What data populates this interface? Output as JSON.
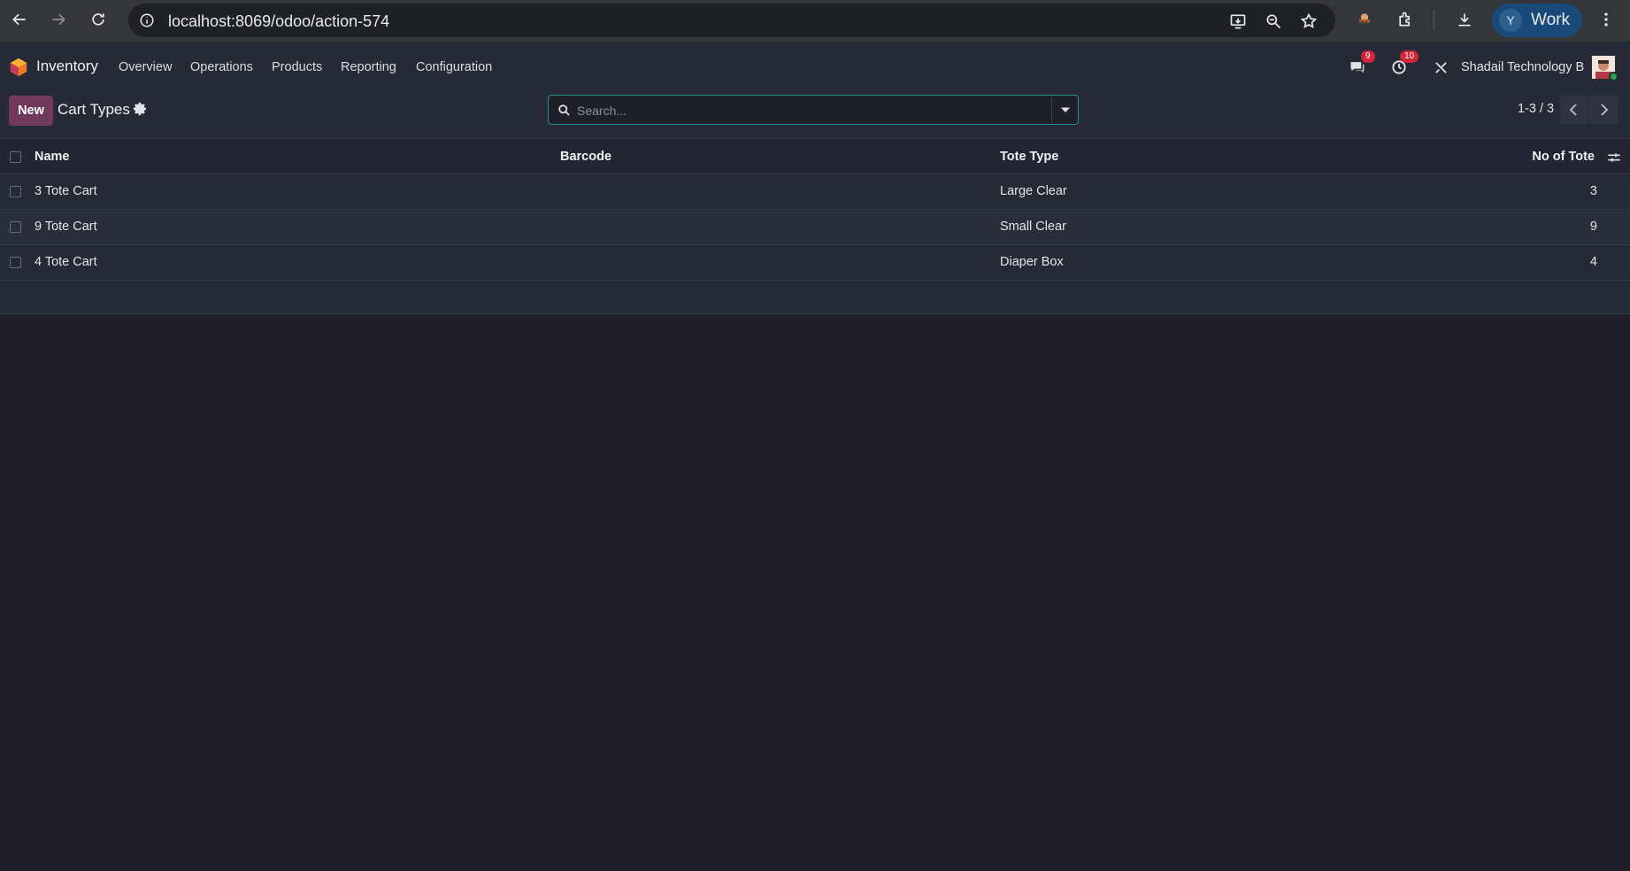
{
  "browser": {
    "url": "localhost:8069/odoo/action-574",
    "profile_initial": "Y",
    "profile_label": "Work"
  },
  "navbar": {
    "app_name": "Inventory",
    "menu": [
      "Overview",
      "Operations",
      "Products",
      "Reporting",
      "Configuration"
    ],
    "messages_count": "9",
    "activities_count": "10",
    "company": "Shadail Technology B"
  },
  "control": {
    "new_label": "New",
    "breadcrumb": "Cart Types",
    "search_placeholder": "Search...",
    "pager": "1-3 / 3"
  },
  "table": {
    "headers": {
      "name": "Name",
      "barcode": "Barcode",
      "tote_type": "Tote Type",
      "count": "No of Tote"
    },
    "rows": [
      {
        "name": "3 Tote Cart",
        "barcode": "",
        "tote_type": "Large Clear",
        "count": "3"
      },
      {
        "name": "9 Tote Cart",
        "barcode": "",
        "tote_type": "Small Clear",
        "count": "9"
      },
      {
        "name": "4 Tote Cart",
        "barcode": "",
        "tote_type": "Diaper Box",
        "count": "4"
      }
    ]
  },
  "colors": {
    "accent": "#71395e",
    "badge": "#d2263b",
    "search_border": "#2f8f8f",
    "background": "#1e1d29"
  }
}
